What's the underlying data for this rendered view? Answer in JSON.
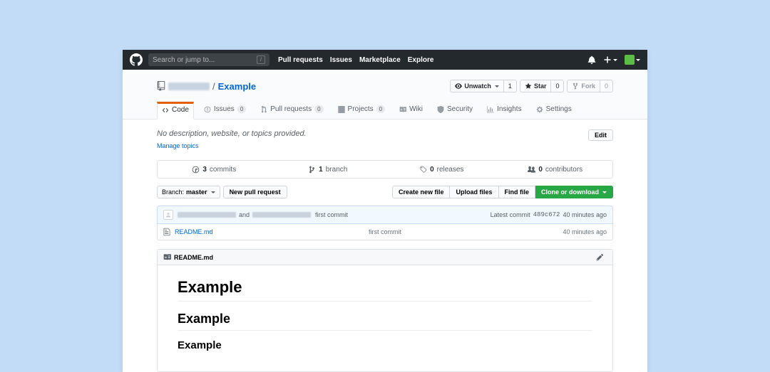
{
  "topbar": {
    "search_placeholder": "Search or jump to...",
    "nav": [
      "Pull requests",
      "Issues",
      "Marketplace",
      "Explore"
    ]
  },
  "repo": {
    "name": "Example",
    "separator": "/"
  },
  "actions": {
    "unwatch": {
      "label": "Unwatch",
      "count": "1"
    },
    "star": {
      "label": "Star",
      "count": "0"
    },
    "fork": {
      "label": "Fork",
      "count": "0"
    }
  },
  "tabs": {
    "code": "Code",
    "issues": {
      "label": "Issues",
      "count": "0"
    },
    "prs": {
      "label": "Pull requests",
      "count": "0"
    },
    "projects": {
      "label": "Projects",
      "count": "0"
    },
    "wiki": "Wiki",
    "security": "Security",
    "insights": "Insights",
    "settings": "Settings"
  },
  "desc": {
    "text": "No description, website, or topics provided.",
    "manage": "Manage topics",
    "edit": "Edit"
  },
  "stats": {
    "commits": {
      "count": "3",
      "label": "commits"
    },
    "branches": {
      "count": "1",
      "label": "branch"
    },
    "releases": {
      "count": "0",
      "label": "releases"
    },
    "contributors": {
      "count": "0",
      "label": "contributors"
    }
  },
  "branchbar": {
    "branch_prefix": "Branch:",
    "branch_name": "master",
    "new_pr": "New pull request",
    "create": "Create new file",
    "upload": "Upload files",
    "find": "Find file",
    "clone": "Clone or download"
  },
  "latest_commit": {
    "and": "and",
    "msg": "first commit",
    "prefix": "Latest commit",
    "sha": "489c672",
    "time": "40 minutes ago"
  },
  "files": [
    {
      "name": "README.md",
      "msg": "first commit",
      "time": "40 minutes ago"
    }
  ],
  "readme": {
    "filename": "README.md",
    "h1": "Example",
    "h2": "Example",
    "h3": "Example"
  }
}
